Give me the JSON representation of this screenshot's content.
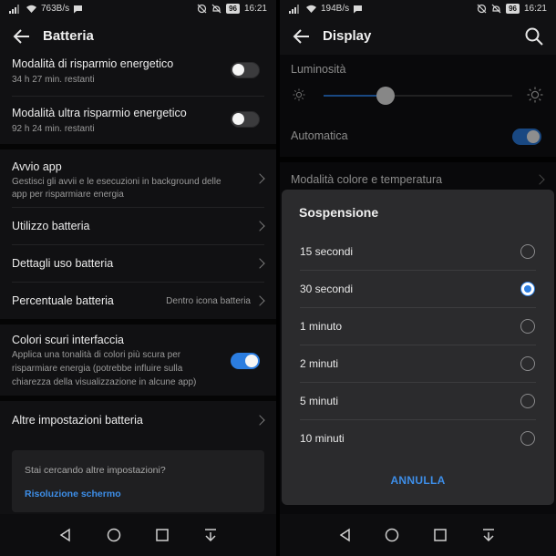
{
  "left": {
    "status": {
      "speed": "763B/s",
      "battery": "96",
      "time": "16:21"
    },
    "header": {
      "title": "Batteria"
    },
    "rows": {
      "power_saving": {
        "title": "Modalità di risparmio energetico",
        "subtitle": "34 h 27 min. restanti",
        "toggle": "off"
      },
      "ultra_saving": {
        "title": "Modalità ultra risparmio energetico",
        "subtitle": "92 h 24 min. restanti",
        "toggle": "off"
      },
      "app_launch": {
        "title": "Avvio app",
        "subtitle_line1": "Gestisci gli avvii e le esecuzioni in background delle",
        "subtitle_line2": "app per risparmiare energia"
      },
      "battery_usage": {
        "title": "Utilizzo batteria"
      },
      "usage_details": {
        "title": "Dettagli uso batteria"
      },
      "battery_percent": {
        "title": "Percentuale batteria",
        "value": "Dentro icona batteria"
      },
      "dark_colors": {
        "title": "Colori scuri interfaccia",
        "subtitle_line1": "Applica una tonalità di colori più scura per",
        "subtitle_line2": "risparmiare energia (potrebbe influire sulla",
        "subtitle_line3": "chiarezza della visualizzazione in alcune app)",
        "toggle": "on"
      },
      "more_settings": {
        "title": "Altre impostazioni batteria"
      }
    },
    "suggest": {
      "question": "Stai cercando altre impostazioni?",
      "link": "Risoluzione schermo"
    }
  },
  "right": {
    "status": {
      "speed": "194B/s",
      "battery": "96",
      "time": "16:21"
    },
    "header": {
      "title": "Display"
    },
    "brightness": {
      "label": "Luminosità",
      "level": 0.33
    },
    "automatic": {
      "label": "Automatica",
      "toggle": "on"
    },
    "color_mode": {
      "title": "Modalità colore e temperatura"
    },
    "dialog": {
      "title": "Sospensione",
      "options": [
        {
          "label": "15 secondi",
          "selected": false
        },
        {
          "label": "30 secondi",
          "selected": true
        },
        {
          "label": "1 minuto",
          "selected": false
        },
        {
          "label": "2 minuti",
          "selected": false
        },
        {
          "label": "5 minuti",
          "selected": false
        },
        {
          "label": "10 minuti",
          "selected": false
        }
      ],
      "cancel": "ANNULLA"
    }
  },
  "colors": {
    "accent": "#2b7de0",
    "link": "#3d8ee8",
    "background": "#111113",
    "dialog": "#2b2b2d"
  },
  "icons": [
    "back-arrow-icon",
    "search-icon",
    "chevron-right-icon",
    "sun-icon",
    "nav-back-icon",
    "nav-home-icon",
    "nav-recents-icon",
    "nav-notifications-icon",
    "wifi-icon",
    "signal-icon",
    "chat-icon",
    "mute-icon",
    "alarm-off-icon"
  ]
}
